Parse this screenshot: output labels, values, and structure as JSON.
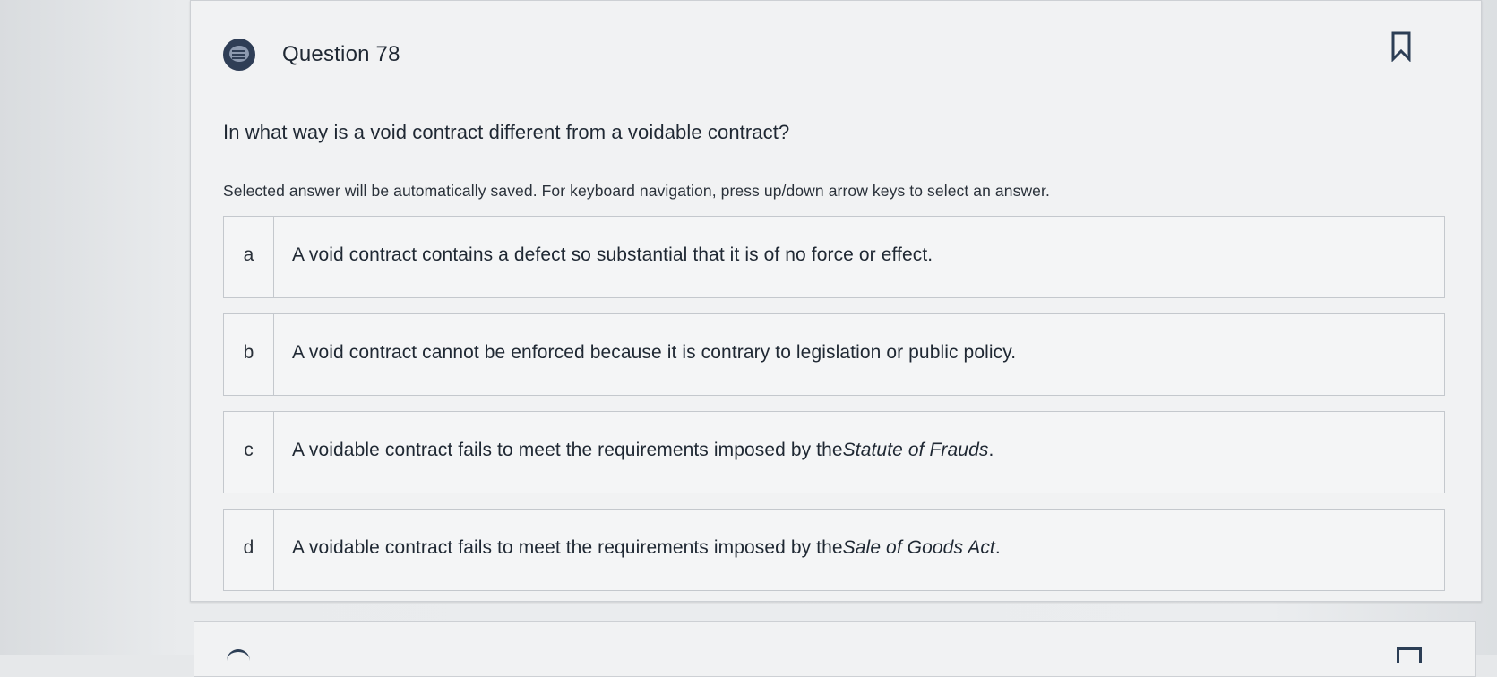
{
  "question": {
    "title": "Question 78",
    "prompt": "In what way is a void contract different from a voidable contract?",
    "instructions": "Selected answer will be automatically saved. For keyboard navigation, press up/down arrow keys to select an answer.",
    "options": [
      {
        "letter": "a",
        "text_before": "A void contract contains a defect so substantial that it is of no force or effect.",
        "italic": "",
        "text_after": ""
      },
      {
        "letter": "b",
        "text_before": "A void contract cannot be enforced because it is contrary to legislation or public policy.",
        "italic": "",
        "text_after": ""
      },
      {
        "letter": "c",
        "text_before": "A voidable contract fails to meet the requirements imposed by the ",
        "italic": "Statute of Frauds",
        "text_after": "."
      },
      {
        "letter": "d",
        "text_before": "A voidable contract fails to meet the requirements imposed by the ",
        "italic": "Sale of Goods Act",
        "text_after": "."
      }
    ]
  },
  "icons": {
    "question": "question-list-icon",
    "bookmark": "bookmark-icon"
  },
  "colors": {
    "icon_navy": "#2f3e56",
    "card_background": "#f1f2f3",
    "border": "#c4c8cd"
  }
}
